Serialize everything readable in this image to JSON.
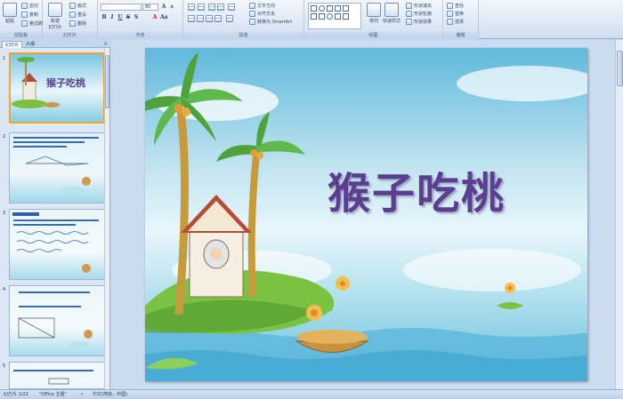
{
  "ribbon": {
    "clipboard": {
      "paste": "粘贴",
      "cut": "剪切",
      "copy": "复制",
      "format_painter": "格式刷",
      "label": "剪贴板"
    },
    "slides": {
      "new_slide": "新建\n幻灯片",
      "layout": "版式",
      "reset": "重设",
      "delete": "删除",
      "label": "幻灯片"
    },
    "font": {
      "size": "80",
      "label": "字体"
    },
    "paragraph": {
      "text_direction": "文字方向",
      "align_text": "对齐文本",
      "smartart": "转换为 SmartArt",
      "label": "段落"
    },
    "drawing": {
      "arrange": "排列",
      "quick_styles": "快速样式",
      "shape_fill": "形状填充",
      "shape_outline": "形状轮廓",
      "shape_effects": "形状效果",
      "label": "绘图"
    },
    "editing": {
      "find": "查找",
      "replace": "替换",
      "select": "选择",
      "label": "编辑"
    }
  },
  "pane": {
    "tab_slides": "幻灯片",
    "tab_outline": "大纲",
    "close": "×",
    "slides": [
      {
        "number": "1",
        "title": "猴子吃桃"
      },
      {
        "number": "2",
        "title": ""
      },
      {
        "number": "3",
        "title": ""
      },
      {
        "number": "4",
        "title": ""
      },
      {
        "number": "5",
        "title": ""
      }
    ]
  },
  "slide": {
    "title": "猴子吃桃"
  },
  "status": {
    "slide_of": "幻灯片 1/22",
    "theme": "\"Office 主题\"",
    "language": "中文(简体，中国)"
  }
}
